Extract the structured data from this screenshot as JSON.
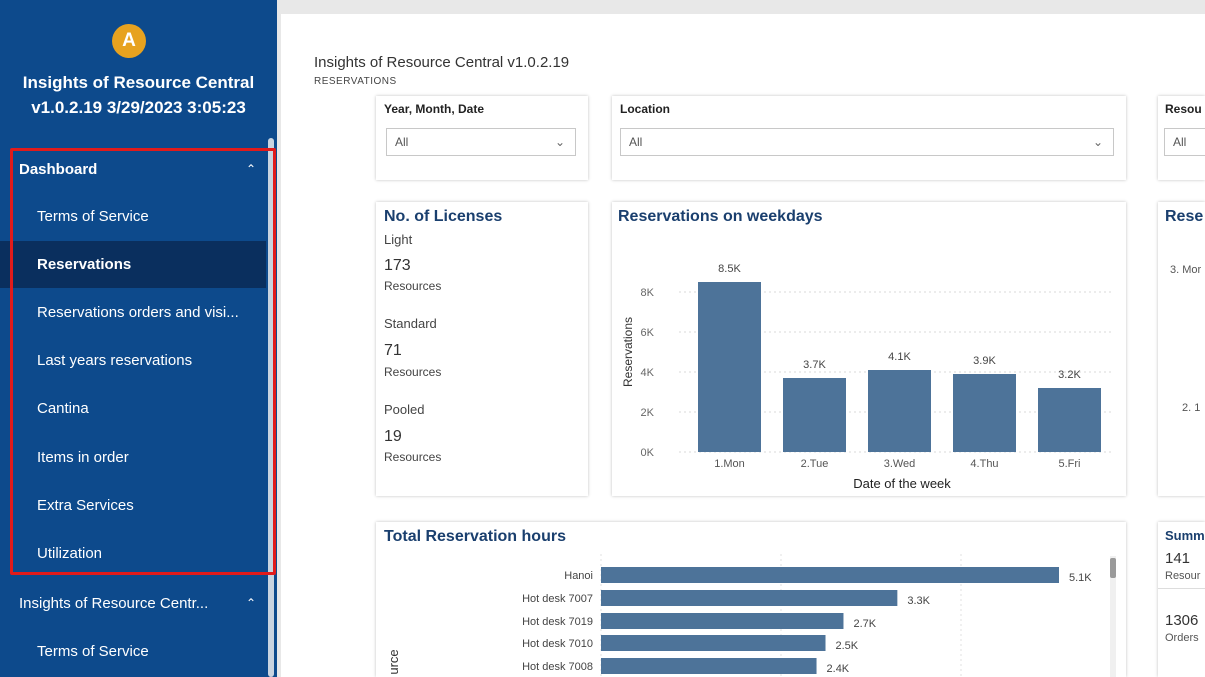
{
  "app": {
    "logo_letter": "A",
    "title_line1": "Insights of Resource Central",
    "title_line2": "v1.0.2.19 3/29/2023 3:05:23"
  },
  "nav": {
    "section1": {
      "label": "Dashboard",
      "chevron": "^"
    },
    "items": [
      {
        "label": "Terms of Service",
        "active": false
      },
      {
        "label": "Reservations",
        "active": true
      },
      {
        "label": "Reservations orders and visi...",
        "active": false
      },
      {
        "label": "Last years reservations",
        "active": false
      },
      {
        "label": "Cantina",
        "active": false
      },
      {
        "label": "Items in order",
        "active": false
      },
      {
        "label": "Extra Services",
        "active": false
      },
      {
        "label": "Utilization",
        "active": false
      }
    ],
    "section2": {
      "label": "Insights of Resource Centr...",
      "chevron": "^"
    },
    "section2_items": [
      {
        "label": "Terms of Service"
      }
    ],
    "highlight_color": "#e11b1b"
  },
  "report": {
    "title": "Insights of Resource Central v1.0.2.19",
    "subtitle": "RESERVATIONS"
  },
  "filters": [
    {
      "label": "Year, Month, Date",
      "value": "All"
    },
    {
      "label": "Location",
      "value": "All"
    },
    {
      "label": "Resou",
      "value": "All"
    }
  ],
  "licenses": {
    "title": "No. of Licenses",
    "groups": [
      {
        "label": "Light",
        "count": "173",
        "unit": "Resources"
      },
      {
        "label": "Standard",
        "count": "71",
        "unit": "Resources"
      },
      {
        "label": "Pooled",
        "count": "19",
        "unit": "Resources"
      }
    ]
  },
  "weekday_chart": {
    "title": "Reservations on weekdays",
    "xlabel": "Date of the week",
    "ylabel": "Reservations",
    "yticks": [
      "8K",
      "6K",
      "4K",
      "2K",
      "0K"
    ],
    "categories": [
      "1.Mon",
      "2.Tue",
      "3.Wed",
      "4.Thu",
      "5.Fri"
    ],
    "values": [
      8500,
      3700,
      4100,
      3900,
      3200
    ],
    "labels": [
      "8.5K",
      "3.7K",
      "4.1K",
      "3.9K",
      "3.2K"
    ],
    "ymax": 10000,
    "color": "#4d7399"
  },
  "right_panel": {
    "title": "Rese",
    "labels": [
      "3. Mor",
      "2. 1"
    ]
  },
  "hours_chart": {
    "title": "Total Reservation hours",
    "axis_label": "urce",
    "categories": [
      "Hanoi",
      "Hot desk 7007",
      "Hot desk 7019",
      "Hot desk 7010",
      "Hot desk 7008"
    ],
    "values": [
      5100,
      3300,
      2700,
      2500,
      2400
    ],
    "labels": [
      "5.1K",
      "3.3K",
      "2.7K",
      "2.5K",
      "2.4K"
    ],
    "xmax": 5500,
    "color": "#4d7399"
  },
  "summary": {
    "title": "Summ",
    "items": [
      {
        "value": "141",
        "label": "Resour"
      },
      {
        "value": "1306",
        "label": "Orders"
      }
    ]
  },
  "chart_data": [
    {
      "type": "bar",
      "title": "Reservations on weekdays",
      "categories": [
        "1.Mon",
        "2.Tue",
        "3.Wed",
        "4.Thu",
        "5.Fri"
      ],
      "values": [
        8500,
        3700,
        4100,
        3900,
        3200
      ],
      "xlabel": "Date of the week",
      "ylabel": "Reservations",
      "ylim": [
        0,
        10000
      ]
    },
    {
      "type": "bar",
      "title": "Total Reservation hours",
      "categories": [
        "Hanoi",
        "Hot desk 7007",
        "Hot desk 7019",
        "Hot desk 7010",
        "Hot desk 7008"
      ],
      "values": [
        5100,
        3300,
        2700,
        2500,
        2400
      ],
      "orientation": "horizontal"
    }
  ]
}
